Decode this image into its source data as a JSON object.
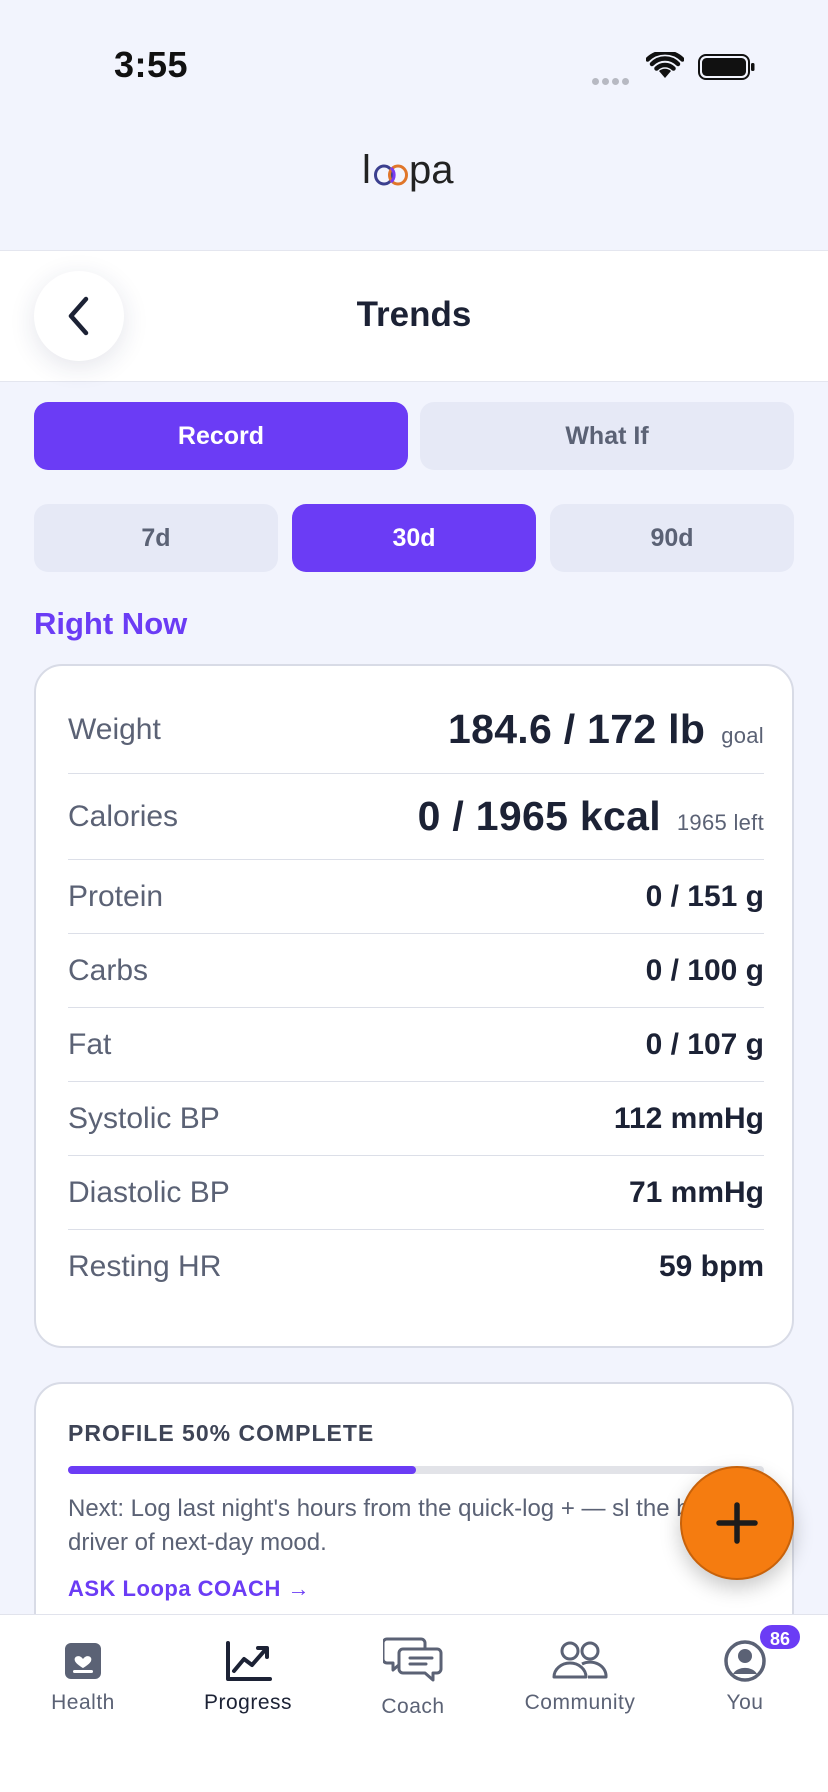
{
  "status_bar": {
    "time": "3:55"
  },
  "app": {
    "logo_text": "loopa"
  },
  "header": {
    "title": "Trends"
  },
  "mode_tabs": [
    {
      "label": "Record",
      "active": true
    },
    {
      "label": "What If",
      "active": false
    }
  ],
  "range_tabs": [
    {
      "label": "7d",
      "active": false
    },
    {
      "label": "30d",
      "active": true
    },
    {
      "label": "90d",
      "active": false
    }
  ],
  "right_now": {
    "section_title": "Right Now",
    "metrics": [
      {
        "label": "Weight",
        "value": "184.6 / 172 lb",
        "sub": "goal"
      },
      {
        "label": "Calories",
        "value": "0 / 1965 kcal",
        "sub": "1965 left"
      },
      {
        "label": "Protein",
        "value": "0 / 151 g"
      },
      {
        "label": "Carbs",
        "value": "0 / 100 g"
      },
      {
        "label": "Fat",
        "value": "0 / 107 g"
      },
      {
        "label": "Systolic BP",
        "value": "112 mmHg"
      },
      {
        "label": "Diastolic BP",
        "value": "71 mmHg"
      },
      {
        "label": "Resting HR",
        "value": "59 bpm"
      }
    ]
  },
  "profile": {
    "title": "PROFILE 50% COMPLETE",
    "progress_percent": 50,
    "next_text": "Next: Log last night's hours from the quick-log + — sl the biggest driver of next-day mood.",
    "coach_link": "ASK Loopa COACH →"
  },
  "colors": {
    "accent": "#6b3cf5",
    "fab": "#f57c10",
    "background": "#f2f4fd"
  },
  "tab_bar": {
    "items": [
      {
        "label": "Health",
        "icon": "health-icon",
        "active": false
      },
      {
        "label": "Progress",
        "icon": "progress-chart-icon",
        "active": true
      },
      {
        "label": "Coach",
        "icon": "coach-chat-icon",
        "active": false
      },
      {
        "label": "Community",
        "icon": "community-icon",
        "active": false
      },
      {
        "label": "You",
        "icon": "profile-icon",
        "active": false,
        "badge": "86"
      }
    ]
  }
}
